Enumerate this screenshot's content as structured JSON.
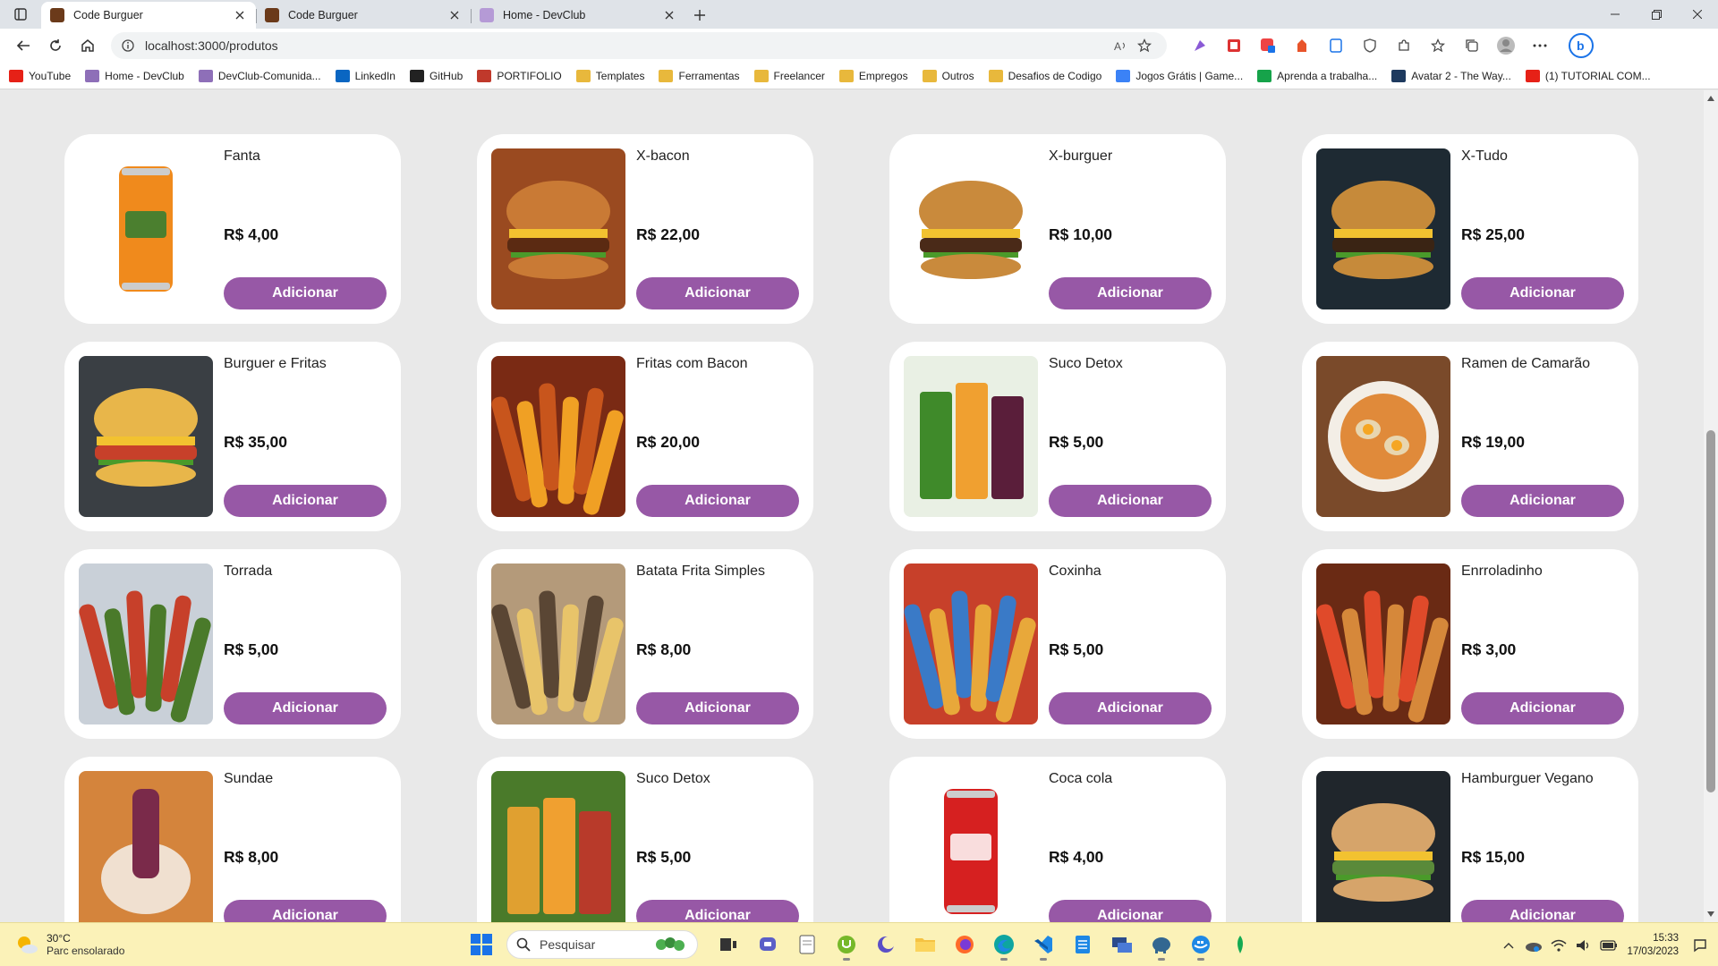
{
  "browser": {
    "tabs": [
      {
        "title": "Code Burguer",
        "active": true,
        "icon": "burger-favicon"
      },
      {
        "title": "Code Burguer",
        "active": false,
        "icon": "burger-favicon"
      },
      {
        "title": "Home - DevClub",
        "active": false,
        "icon": "devclub-favicon"
      }
    ],
    "url": "localhost:3000/produtos",
    "bookmarks": [
      {
        "label": "YouTube",
        "color": "#e62117"
      },
      {
        "label": "Home - DevClub",
        "color": "#8e6fb8"
      },
      {
        "label": "DevClub-Comunida...",
        "color": "#8e6fb8"
      },
      {
        "label": "LinkedIn",
        "color": "#0a66c2"
      },
      {
        "label": "GitHub",
        "color": "#222222"
      },
      {
        "label": "PORTIFOLIO",
        "color": "#c0392b"
      },
      {
        "label": "Templates",
        "color": "#e8b83c"
      },
      {
        "label": "Ferramentas",
        "color": "#e8b83c"
      },
      {
        "label": "Freelancer",
        "color": "#e8b83c"
      },
      {
        "label": "Empregos",
        "color": "#e8b83c"
      },
      {
        "label": "Outros",
        "color": "#e8b83c"
      },
      {
        "label": "Desafios de Codigo",
        "color": "#e8b83c"
      },
      {
        "label": "Jogos Grátis | Game...",
        "color": "#3b82f6"
      },
      {
        "label": "Aprenda a trabalha...",
        "color": "#16a34a"
      },
      {
        "label": "Avatar 2 - The Way...",
        "color": "#1e3a5f"
      },
      {
        "label": "(1) TUTORIAL COM...",
        "color": "#e62117"
      }
    ]
  },
  "accent": "#9758a6",
  "products": [
    {
      "name": "Fanta",
      "price": "R$ 4,00",
      "button": "Adicionar",
      "image": "fanta-can",
      "bg": "#ffffff",
      "c1": "#f08a1c",
      "c2": "#2e7d32"
    },
    {
      "name": "X-bacon",
      "price": "R$ 22,00",
      "button": "Adicionar",
      "image": "bacon-burger",
      "bg": "#9a4a20",
      "c1": "#c97a35",
      "c2": "#5b2a12"
    },
    {
      "name": "X-burguer",
      "price": "R$ 10,00",
      "button": "Adicionar",
      "image": "classic-burger",
      "bg": "#ffffff",
      "c1": "#c98a3c",
      "c2": "#4a2a18"
    },
    {
      "name": "X-Tudo",
      "price": "R$ 25,00",
      "button": "Adicionar",
      "image": "loaded-burger",
      "bg": "#1e2a33",
      "c1": "#c68a3a",
      "c2": "#3a2414"
    },
    {
      "name": "Burguer e Fritas",
      "price": "R$ 35,00",
      "button": "Adicionar",
      "image": "burger-fries-plate",
      "bg": "#3a3f44",
      "c1": "#e8b64a",
      "c2": "#c7402a"
    },
    {
      "name": "Fritas com Bacon",
      "price": "R$ 20,00",
      "button": "Adicionar",
      "image": "bacon-fries",
      "bg": "#7a2a14",
      "c1": "#f0a024",
      "c2": "#c8551c"
    },
    {
      "name": "Suco Detox",
      "price": "R$ 5,00",
      "button": "Adicionar",
      "image": "detox-juices",
      "bg": "#e9f0e4",
      "c1": "#3f8a2a",
      "c2": "#5a1e3a"
    },
    {
      "name": "Ramen de Camarão",
      "price": "R$ 19,00",
      "button": "Adicionar",
      "image": "ramen-bowl",
      "bg": "#7a4a2a",
      "c1": "#e8d6b0",
      "c2": "#e08a3a"
    },
    {
      "name": "Torrada",
      "price": "R$ 5,00",
      "button": "Adicionar",
      "image": "toast-board",
      "bg": "#c9d0d8",
      "c1": "#4a7a2a",
      "c2": "#c7402a"
    },
    {
      "name": "Batata Frita Simples",
      "price": "R$ 8,00",
      "button": "Adicionar",
      "image": "simple-fries",
      "bg": "#b49a7a",
      "c1": "#e8c46a",
      "c2": "#5a4634"
    },
    {
      "name": "Coxinha",
      "price": "R$ 5,00",
      "button": "Adicionar",
      "image": "coxinha",
      "bg": "#c7402a",
      "c1": "#e8a83a",
      "c2": "#3a7ac7"
    },
    {
      "name": "Enrroladinho",
      "price": "R$ 3,00",
      "button": "Adicionar",
      "image": "sausage-rolls",
      "bg": "#6a2a14",
      "c1": "#d6883a",
      "c2": "#e04a2a"
    },
    {
      "name": "Sundae",
      "price": "R$ 8,00",
      "button": "Adicionar",
      "image": "sundae",
      "bg": "#d4843c",
      "c1": "#f0e0d0",
      "c2": "#7a2a4a"
    },
    {
      "name": "Suco Detox",
      "price": "R$ 5,00",
      "button": "Adicionar",
      "image": "detox-bottles",
      "bg": "#4a7a2a",
      "c1": "#e0a030",
      "c2": "#b83a2a"
    },
    {
      "name": "Coca cola",
      "price": "R$ 4,00",
      "button": "Adicionar",
      "image": "coca-cola-can",
      "bg": "#ffffff",
      "c1": "#d62020",
      "c2": "#ffffff"
    },
    {
      "name": "Hamburguer Vegano",
      "price": "R$ 15,00",
      "button": "Adicionar",
      "image": "vegan-burger",
      "bg": "#20262c",
      "c1": "#d6a46a",
      "c2": "#5a8a3a"
    }
  ],
  "taskbar": {
    "weather_temp": "30°C",
    "weather_desc": "Parc ensolarado",
    "search_placeholder": "Pesquisar",
    "time": "15:33",
    "date": "17/03/2023"
  }
}
